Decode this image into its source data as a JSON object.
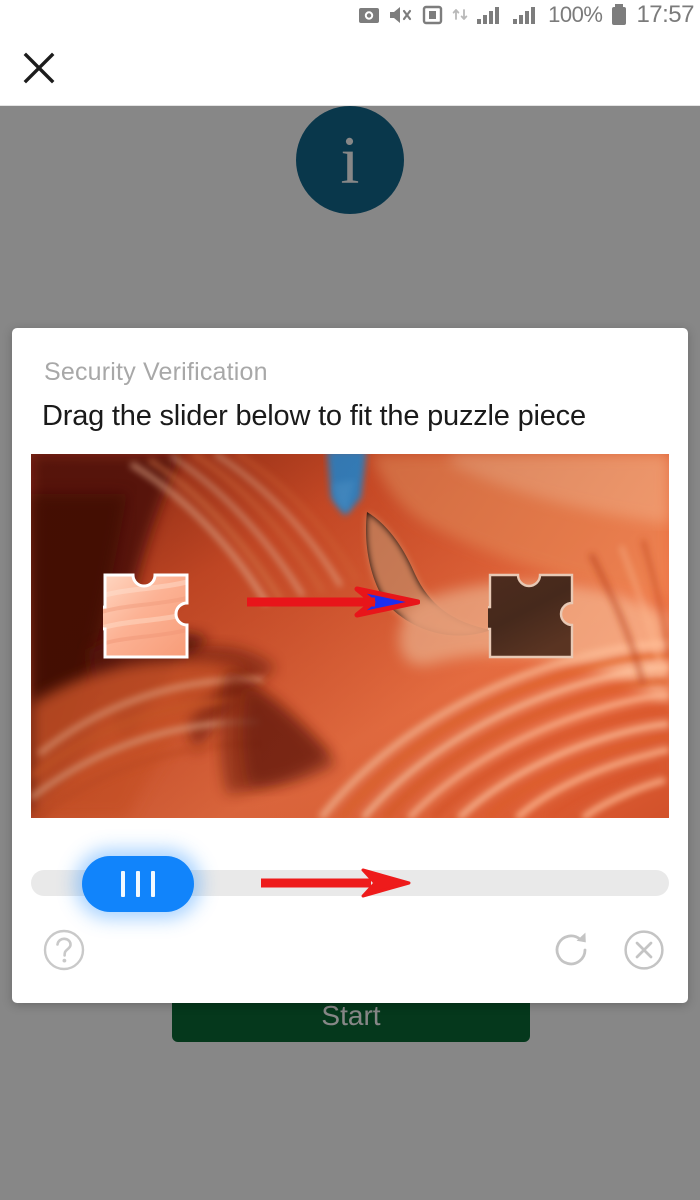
{
  "status_bar": {
    "icons": [
      "camera-icon",
      "mute-icon",
      "sd-card-icon",
      "data-transfer-icon",
      "signal-bars-1-icon",
      "signal-bars-2-icon"
    ],
    "battery_percent": "100%",
    "battery_icon": "battery-full-icon",
    "time": "17:57"
  },
  "app_header": {
    "close_icon": "close-x-icon"
  },
  "page": {
    "info_badge_glyph": "i",
    "info_badge_color": "#12688f",
    "start_button_label": "Start",
    "start_button_color": "#0b6b35"
  },
  "captcha": {
    "title": "Security Verification",
    "instruction": "Drag the slider below to fit the puzzle piece",
    "image": {
      "description": "slot-canyon-photo",
      "piece_icon": "puzzle-piece-icon",
      "slot_icon": "puzzle-slot-icon",
      "arrow_icon": "drag-direction-arrow-icon",
      "arrow_outline_color": "#e8151a",
      "arrow_fill_color": "#1c2ff0"
    },
    "slider": {
      "handle_icon": "slider-grip-icon",
      "handle_color": "#1184fb",
      "track_color": "#e9e9e9",
      "position_percent": "8",
      "hint_arrow_icon": "slider-hint-arrow-icon",
      "hint_arrow_color": "#ee1b1b"
    },
    "footer": {
      "help_icon": "help-question-icon",
      "refresh_icon": "refresh-icon",
      "close_icon": "close-circle-icon"
    }
  },
  "colors": {
    "scrim": "#808080",
    "title_gray": "#a8a8a8",
    "text_dark": "#1a1a1a",
    "footer_icon_gray": "#c4c4c4"
  }
}
